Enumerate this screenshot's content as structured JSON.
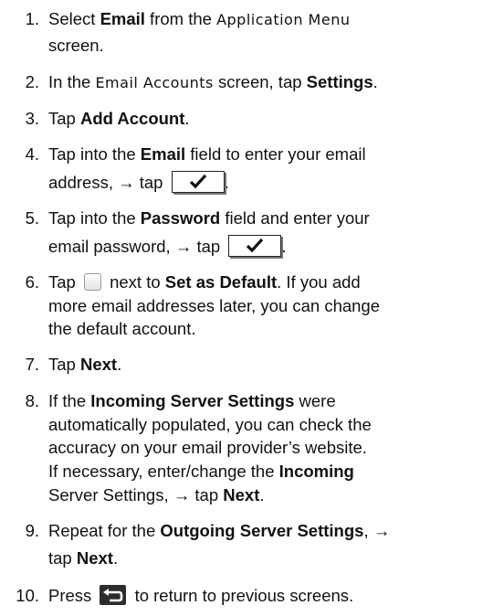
{
  "steps": [
    {
      "num": "1.",
      "l1": [
        "Select ",
        "Email",
        " from the ",
        "Application Menu"
      ],
      "l2": "screen."
    },
    {
      "num": "2.",
      "l1": [
        "In the ",
        "Email Accounts",
        " screen, tap ",
        "Settings",
        "."
      ]
    },
    {
      "num": "3.",
      "l1": [
        "Tap ",
        "Add Account",
        "."
      ]
    },
    {
      "num": "4.",
      "l1": [
        "Tap into the ",
        "Email",
        " field to enter your email"
      ],
      "l2": "address, → tap"
    },
    {
      "num": "5.",
      "l1": [
        "Tap into the ",
        "Password",
        " field and enter your"
      ],
      "l2": "email password, → tap"
    },
    {
      "num": "6.",
      "l1": [
        "Tap",
        "next to ",
        "Set as Default",
        ". If you add"
      ],
      "l2": "more email addresses later, you can change",
      "l3": "the default account."
    },
    {
      "num": "7.",
      "l1": [
        "Tap ",
        "Next",
        "."
      ]
    },
    {
      "num": "8.",
      "l1": [
        "If the ",
        "Incoming Server Settings",
        " were"
      ],
      "l2": "automatically populated, you can check the",
      "l3": "accuracy on your email provider’s website.",
      "l4": [
        "If necessary, enter/change the ",
        "Incoming"
      ],
      "l5": [
        "Server Settings, → tap ",
        "Next",
        "."
      ]
    },
    {
      "num": "9.",
      "l1": [
        "Repeat for the ",
        "Outgoing Server Settings",
        ", →"
      ],
      "l2": [
        "tap ",
        "Next",
        "."
      ]
    },
    {
      "num": "10.",
      "l1": [
        "Press",
        "to return to previous screens."
      ]
    }
  ]
}
